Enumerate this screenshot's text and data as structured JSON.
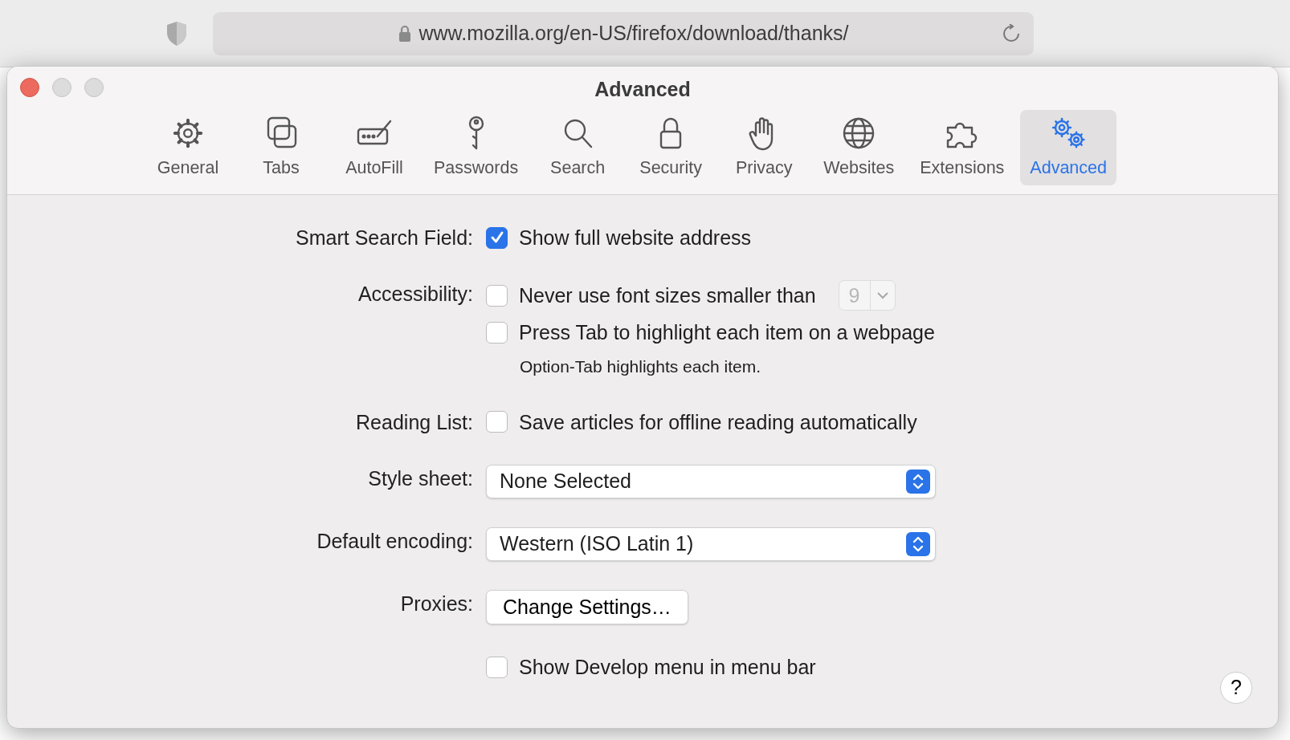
{
  "browser": {
    "url": "www.mozilla.org/en-US/firefox/download/thanks/"
  },
  "window": {
    "title": "Advanced"
  },
  "toolbar": [
    {
      "label": "General",
      "kind": "gear",
      "selected": false
    },
    {
      "label": "Tabs",
      "kind": "tabs",
      "selected": false
    },
    {
      "label": "AutoFill",
      "kind": "autofill",
      "selected": false
    },
    {
      "label": "Passwords",
      "kind": "key",
      "selected": false
    },
    {
      "label": "Search",
      "kind": "search",
      "selected": false
    },
    {
      "label": "Security",
      "kind": "lock",
      "selected": false
    },
    {
      "label": "Privacy",
      "kind": "hand",
      "selected": false
    },
    {
      "label": "Websites",
      "kind": "globe",
      "selected": false
    },
    {
      "label": "Extensions",
      "kind": "puzzle",
      "selected": false
    },
    {
      "label": "Advanced",
      "kind": "gears",
      "selected": true
    }
  ],
  "sections": [
    {
      "label": "Smart Search Field:",
      "controls": [
        {
          "kind": "checkbox",
          "text": "Show full website address",
          "checked": true
        }
      ]
    },
    {
      "label": "Accessibility:",
      "controls": [
        {
          "kind": "checkbox",
          "text": "Never use font sizes smaller than",
          "checked": false,
          "size_field": {
            "value": "9",
            "disabled": true
          }
        },
        {
          "kind": "checkbox",
          "text": "Press Tab to highlight each item on a webpage",
          "checked": false
        },
        {
          "kind": "note",
          "text": "Option-Tab highlights each item."
        }
      ]
    },
    {
      "label": "Reading List:",
      "controls": [
        {
          "kind": "checkbox",
          "text": "Save articles for offline reading automatically",
          "checked": false
        }
      ]
    },
    {
      "label": "Style sheet:",
      "controls": [
        {
          "kind": "popup",
          "value": "None Selected"
        }
      ]
    },
    {
      "label": "Default encoding:",
      "controls": [
        {
          "kind": "popup",
          "value": "Western (ISO Latin 1)"
        }
      ]
    },
    {
      "label": "Proxies:",
      "controls": [
        {
          "kind": "button",
          "text": "Change Settings…"
        }
      ]
    },
    {
      "controls": [
        {
          "kind": "checkbox",
          "text": "Show Develop menu in menu bar",
          "checked": false
        }
      ]
    }
  ],
  "help": "?"
}
